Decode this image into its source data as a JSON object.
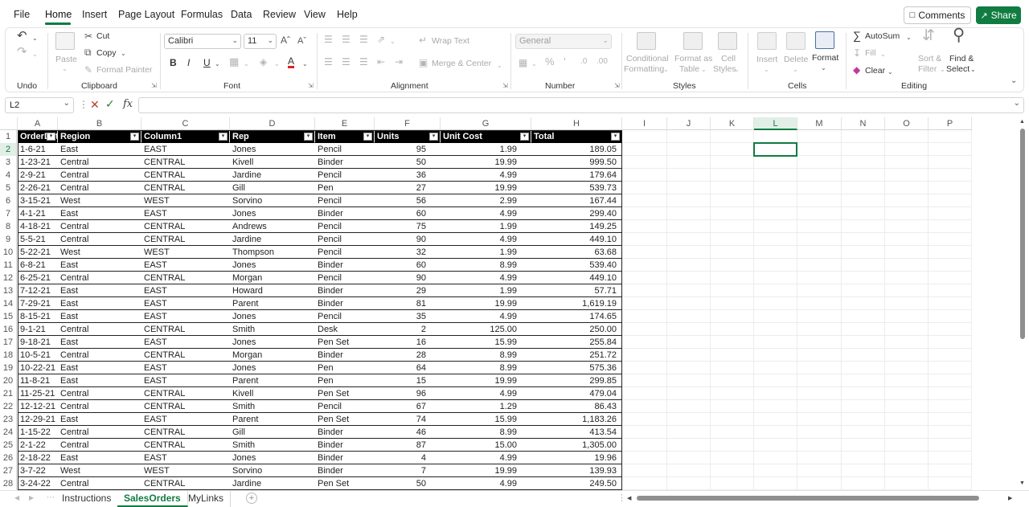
{
  "menu": {
    "tabs": [
      "File",
      "Home",
      "Insert",
      "Page Layout",
      "Formulas",
      "Data",
      "Review",
      "View",
      "Help"
    ],
    "active": "Home"
  },
  "actions": {
    "comments": "Comments",
    "share": "Share"
  },
  "colors": {
    "accent": "#107c41",
    "header_bg": "#000000",
    "header_text": "#ffffff"
  },
  "ribbon": {
    "clipboard": {
      "label": "Clipboard",
      "paste": "Paste",
      "cut": "Cut",
      "copy": "Copy",
      "format_painter": "Format Painter"
    },
    "undo": {
      "label": "Undo"
    },
    "font": {
      "label": "Font",
      "name": "Calibri",
      "size": "11"
    },
    "alignment": {
      "label": "Alignment",
      "wrap": "Wrap Text",
      "merge": "Merge & Center"
    },
    "number": {
      "label": "Number",
      "format": "General"
    },
    "styles": {
      "label": "Styles",
      "conditional": "Conditional",
      "formatting": "Formatting",
      "format_as": "Format as",
      "table": "Table",
      "cell": "Cell",
      "styles_btn": "Styles"
    },
    "cells": {
      "label": "Cells",
      "insert": "Insert",
      "delete": "Delete",
      "format": "Format"
    },
    "editing": {
      "label": "Editing",
      "autosum": "AutoSum",
      "fill": "Fill",
      "clear": "Clear",
      "sort": "Sort &",
      "filter": "Filter",
      "find": "Find &",
      "select": "Select"
    }
  },
  "formula_bar": {
    "name_box": "L2",
    "fx": "fx",
    "value": ""
  },
  "sheet": {
    "columns": [
      "A",
      "B",
      "C",
      "D",
      "E",
      "F",
      "G",
      "H",
      "I",
      "J",
      "K",
      "L",
      "M",
      "N",
      "O",
      "P"
    ],
    "selected_cell": "L2",
    "headers": [
      "OrderDate",
      "Region",
      "Column1",
      "Rep",
      "Item",
      "Units",
      "Unit Cost",
      "Total"
    ],
    "rows": [
      [
        "1-6-21",
        "East",
        "EAST",
        "Jones",
        "Pencil",
        "95",
        "1.99",
        "189.05"
      ],
      [
        "1-23-21",
        "Central",
        "CENTRAL",
        "Kivell",
        "Binder",
        "50",
        "19.99",
        "999.50"
      ],
      [
        "2-9-21",
        "Central",
        "CENTRAL",
        "Jardine",
        "Pencil",
        "36",
        "4.99",
        "179.64"
      ],
      [
        "2-26-21",
        "Central",
        "CENTRAL",
        "Gill",
        "Pen",
        "27",
        "19.99",
        "539.73"
      ],
      [
        "3-15-21",
        "West",
        "WEST",
        "Sorvino",
        "Pencil",
        "56",
        "2.99",
        "167.44"
      ],
      [
        "4-1-21",
        "East",
        "EAST",
        "Jones",
        "Binder",
        "60",
        "4.99",
        "299.40"
      ],
      [
        "4-18-21",
        "Central",
        "CENTRAL",
        "Andrews",
        "Pencil",
        "75",
        "1.99",
        "149.25"
      ],
      [
        "5-5-21",
        "Central",
        "CENTRAL",
        "Jardine",
        "Pencil",
        "90",
        "4.99",
        "449.10"
      ],
      [
        "5-22-21",
        "West",
        "WEST",
        "Thompson",
        "Pencil",
        "32",
        "1.99",
        "63.68"
      ],
      [
        "6-8-21",
        "East",
        "EAST",
        "Jones",
        "Binder",
        "60",
        "8.99",
        "539.40"
      ],
      [
        "6-25-21",
        "Central",
        "CENTRAL",
        "Morgan",
        "Pencil",
        "90",
        "4.99",
        "449.10"
      ],
      [
        "7-12-21",
        "East",
        "EAST",
        "Howard",
        "Binder",
        "29",
        "1.99",
        "57.71"
      ],
      [
        "7-29-21",
        "East",
        "EAST",
        "Parent",
        "Binder",
        "81",
        "19.99",
        "1,619.19"
      ],
      [
        "8-15-21",
        "East",
        "EAST",
        "Jones",
        "Pencil",
        "35",
        "4.99",
        "174.65"
      ],
      [
        "9-1-21",
        "Central",
        "CENTRAL",
        "Smith",
        "Desk",
        "2",
        "125.00",
        "250.00"
      ],
      [
        "9-18-21",
        "East",
        "EAST",
        "Jones",
        "Pen Set",
        "16",
        "15.99",
        "255.84"
      ],
      [
        "10-5-21",
        "Central",
        "CENTRAL",
        "Morgan",
        "Binder",
        "28",
        "8.99",
        "251.72"
      ],
      [
        "10-22-21",
        "East",
        "EAST",
        "Jones",
        "Pen",
        "64",
        "8.99",
        "575.36"
      ],
      [
        "11-8-21",
        "East",
        "EAST",
        "Parent",
        "Pen",
        "15",
        "19.99",
        "299.85"
      ],
      [
        "11-25-21",
        "Central",
        "CENTRAL",
        "Kivell",
        "Pen Set",
        "96",
        "4.99",
        "479.04"
      ],
      [
        "12-12-21",
        "Central",
        "CENTRAL",
        "Smith",
        "Pencil",
        "67",
        "1.29",
        "86.43"
      ],
      [
        "12-29-21",
        "East",
        "EAST",
        "Parent",
        "Pen Set",
        "74",
        "15.99",
        "1,183.26"
      ],
      [
        "1-15-22",
        "Central",
        "CENTRAL",
        "Gill",
        "Binder",
        "46",
        "8.99",
        "413.54"
      ],
      [
        "2-1-22",
        "Central",
        "CENTRAL",
        "Smith",
        "Binder",
        "87",
        "15.00",
        "1,305.00"
      ],
      [
        "2-18-22",
        "East",
        "EAST",
        "Jones",
        "Binder",
        "4",
        "4.99",
        "19.96"
      ],
      [
        "3-7-22",
        "West",
        "WEST",
        "Sorvino",
        "Binder",
        "7",
        "19.99",
        "139.93"
      ],
      [
        "3-24-22",
        "Central",
        "CENTRAL",
        "Jardine",
        "Pen Set",
        "50",
        "4.99",
        "249.50"
      ]
    ]
  },
  "sheet_tabs": [
    "Instructions",
    "SalesOrders",
    "MyLinks"
  ],
  "active_sheet": "SalesOrders"
}
